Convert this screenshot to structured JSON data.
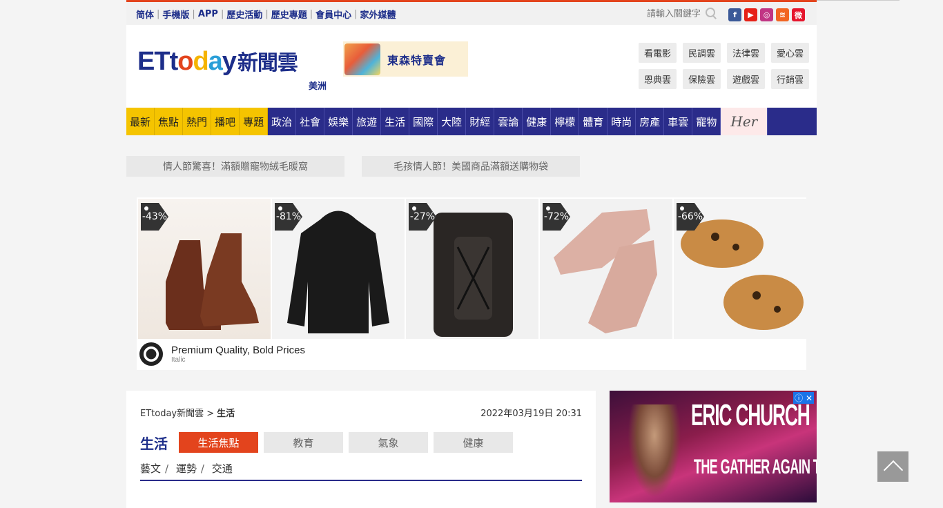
{
  "topbar": {
    "links": [
      "简体",
      "手機版",
      "APP",
      "歷史活動",
      "歷史專題",
      "會員中心",
      "家外媒體"
    ],
    "search_placeholder": "請輸入關鍵字",
    "social": [
      {
        "name": "facebook",
        "glyph": "f",
        "color": "#3b5998"
      },
      {
        "name": "youtube",
        "glyph": "▶",
        "color": "#e62117"
      },
      {
        "name": "instagram",
        "glyph": "◎",
        "color": "#c13584"
      },
      {
        "name": "rss",
        "glyph": "≋",
        "color": "#f26522"
      },
      {
        "name": "weibo",
        "glyph": "微",
        "color": "#e6162d"
      }
    ]
  },
  "header": {
    "logo_cloud": "新聞雲",
    "region": "美洲",
    "banner_text": "東森特賣會",
    "cloud_buttons": [
      "看電影",
      "民調雲",
      "法律雲",
      "愛心雲",
      "恩典雲",
      "保險雲",
      "遊戲雲",
      "行銷雲"
    ]
  },
  "nav": {
    "yellow": [
      "最新",
      "焦點",
      "熱門",
      "播吧",
      "專題"
    ],
    "blue": [
      "政治",
      "社會",
      "娛樂",
      "旅遊",
      "生活",
      "國際",
      "大陸",
      "財經",
      "雲論",
      "健康",
      "檸檬",
      "體育",
      "時尚",
      "房產",
      "車雲",
      "寵物"
    ],
    "her": "Her"
  },
  "promos": [
    "情人節驚喜！滿額贈寵物絨毛暖窩",
    "毛孩情人節！美國商品滿額送購物袋"
  ],
  "ad": {
    "discounts": [
      "-43%",
      "-81%",
      "-27%",
      "-72%",
      "-66%"
    ],
    "product_icons": [
      "boots-icon",
      "hoodie-icon",
      "backpack-icon",
      "sneaker-icon",
      "slipper-icon"
    ],
    "headline": "Premium Quality, Bold Prices",
    "brand": "Italic"
  },
  "article": {
    "breadcrumb_home": "ETtoday新聞雲 >",
    "breadcrumb_section": "生活",
    "date": "2022年03月19日 20:31",
    "section_title": "生活",
    "subtabs": [
      "生活焦點",
      "教育",
      "氣象",
      "健康"
    ],
    "sublinks": [
      "藝文",
      "運勢",
      "交通"
    ]
  },
  "side_ad": {
    "title": "ERIC CHURCH",
    "subtitle": "THE GATHER AGAIN TOUR"
  }
}
